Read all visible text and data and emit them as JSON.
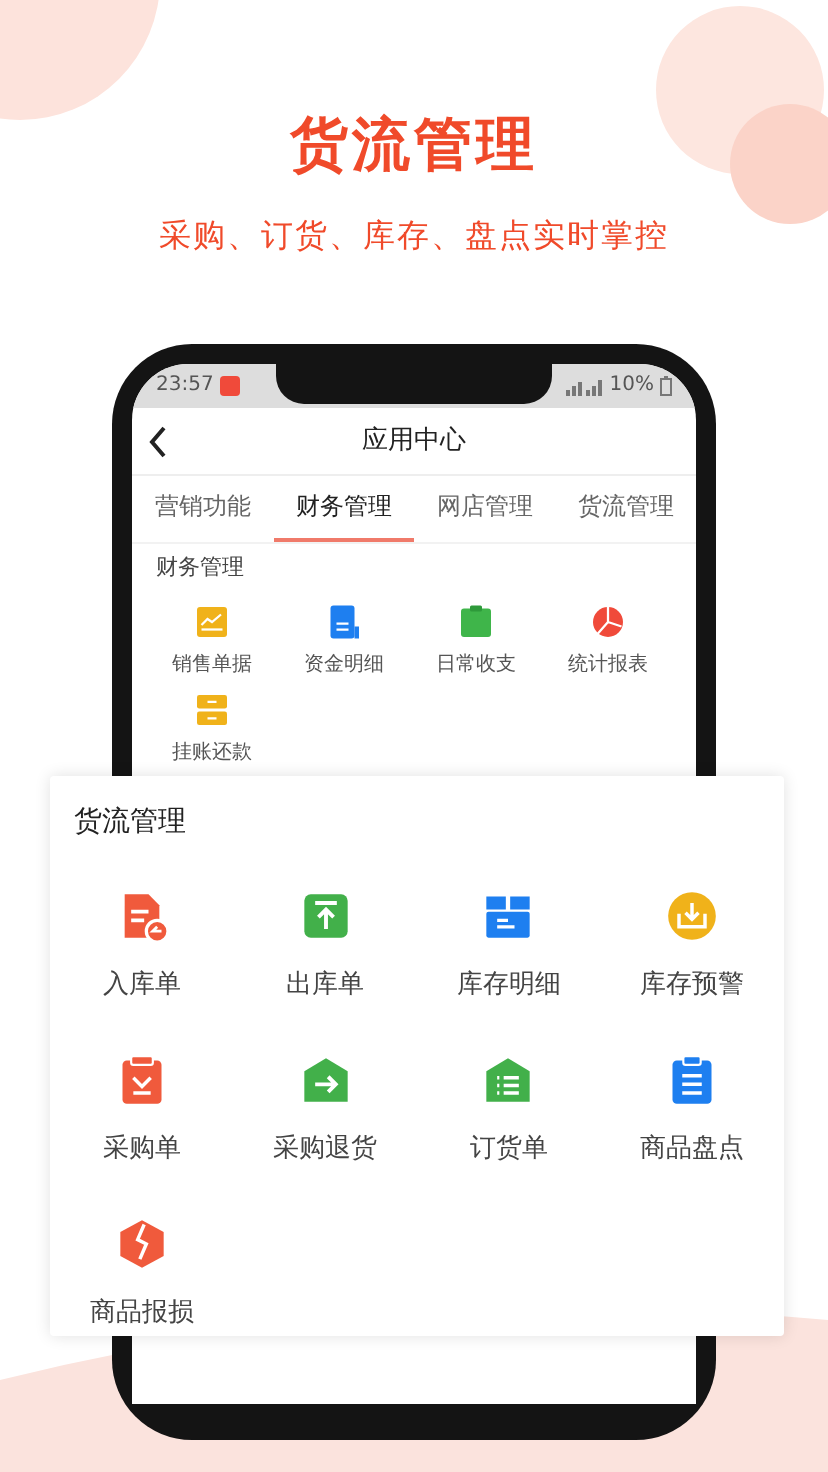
{
  "header": {
    "title": "货流管理",
    "subtitle": "采购、订货、库存、盘点实时掌控"
  },
  "phone": {
    "status_bar": {
      "time": "23:57",
      "battery": "10%"
    },
    "nav_title": "应用中心",
    "tabs": [
      {
        "label": "营销功能",
        "selected": false
      },
      {
        "label": "财务管理",
        "selected": true
      },
      {
        "label": "网店管理",
        "selected": false
      },
      {
        "label": "货流管理",
        "selected": false
      }
    ],
    "section": {
      "title": "财务管理",
      "items": [
        {
          "label": "销售单据",
          "kind": "sales"
        },
        {
          "label": "资金明细",
          "kind": "funds"
        },
        {
          "label": "日常收支",
          "kind": "daily"
        },
        {
          "label": "统计报表",
          "kind": "stats"
        },
        {
          "label": "挂账还款",
          "kind": "credit"
        }
      ]
    }
  },
  "card": {
    "title": "货流管理",
    "items": [
      {
        "label": "入库单",
        "kind": "inbound"
      },
      {
        "label": "出库单",
        "kind": "outbound"
      },
      {
        "label": "库存明细",
        "kind": "stock"
      },
      {
        "label": "库存预警",
        "kind": "alert"
      },
      {
        "label": "采购单",
        "kind": "purchase"
      },
      {
        "label": "采购退货",
        "kind": "return"
      },
      {
        "label": "订货单",
        "kind": "order"
      },
      {
        "label": "商品盘点",
        "kind": "count"
      },
      {
        "label": "商品报损",
        "kind": "damage"
      }
    ]
  }
}
